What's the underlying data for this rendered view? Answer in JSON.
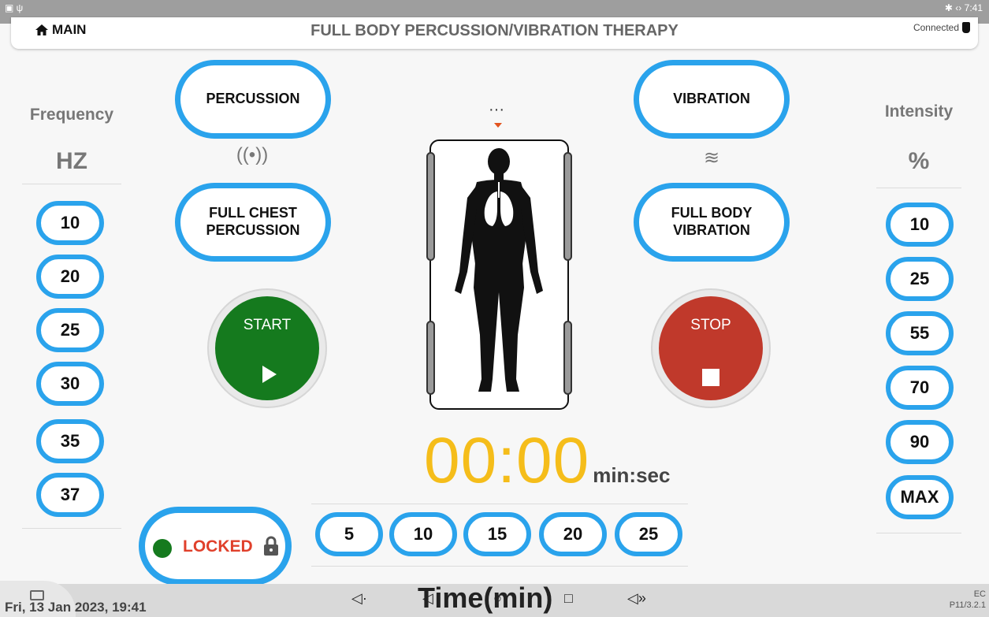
{
  "statusbar": {
    "time": "7:41"
  },
  "header": {
    "home_label": "MAIN",
    "title": "FULL BODY PERCUSSION/VIBRATION THERAPY",
    "connection": "Connected"
  },
  "frequency": {
    "title": "Frequency",
    "unit": "HZ",
    "options": [
      "10",
      "20",
      "25",
      "30",
      "35",
      "37"
    ]
  },
  "intensity": {
    "title": "Intensity",
    "unit": "%",
    "options": [
      "10",
      "25",
      "55",
      "70",
      "90",
      "MAX"
    ]
  },
  "modes": {
    "percussion": "PERCUSSION",
    "vibration": "VIBRATION",
    "full_chest": "FULL CHEST PERCUSSION",
    "full_body": "FULL BODY VIBRATION"
  },
  "controls": {
    "start": "START",
    "stop": "STOP"
  },
  "timer": {
    "value": "00:00",
    "unit": "min:sec"
  },
  "time_options": [
    "5",
    "10",
    "15",
    "20",
    "25"
  ],
  "time_label": "Time(min)",
  "lock": {
    "label": "LOCKED"
  },
  "navbar": {
    "datetime": "Fri, 13 Jan 2023, 19:41",
    "version_top": "EC",
    "version_bottom": "P11/3.2.1"
  },
  "colors": {
    "accent": "#2aa3ec",
    "start": "#157a1e",
    "stop": "#c0392b",
    "timer": "#f5bd1a",
    "locked": "#e0402b"
  }
}
